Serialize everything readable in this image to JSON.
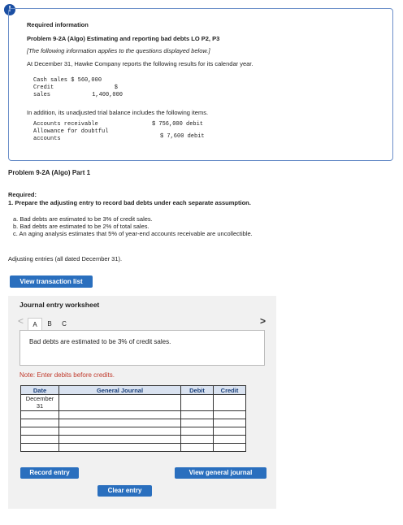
{
  "alert_icon": "!",
  "info": {
    "required_title": "Required information",
    "problem_title": "Problem 9-2A (Algo) Estimating and reporting bad debts LO P2, P3",
    "note": "[The following information applies to the questions displayed below.]",
    "intro": "At December 31, Hawke Company reports the following results for its calendar year.",
    "cash_sales_label": "Cash sales",
    "cash_sales_value": "$ 560,000",
    "credit_label": "Credit",
    "credit_dollar": "$",
    "sales_label": "sales",
    "sales_value": "1,400,000",
    "trial_balance_text": "In addition, its unadjusted trial balance includes the following items.",
    "ar_label": "Accounts receivable",
    "ar_value": "$ 756,000 debit",
    "allowance_label_1": "Allowance for doubtful",
    "allowance_label_2": "accounts",
    "allowance_value": "$ 7,600 debit"
  },
  "part_title": "Problem 9-2A (Algo) Part 1",
  "required": {
    "label": "Required:",
    "item1": "1. Prepare the adjusting entry to record bad debts under each separate assumption.",
    "a": "a. Bad debts are estimated to be 3% of credit sales.",
    "b": "b. Bad debts are estimated to be 2% of total sales.",
    "c": "c. An aging analysis estimates that 5% of year-end accounts receivable are uncollectible."
  },
  "adjusting_label": "Adjusting entries (all dated December 31).",
  "view_transaction_label": "View transaction list",
  "worksheet": {
    "title": "Journal entry worksheet",
    "tabs": [
      "A",
      "B",
      "C"
    ],
    "nav_left": "<",
    "nav_right": ">",
    "description": "Bad debts are estimated to be 3% of credit sales.",
    "note": "Note: Enter debits before credits.",
    "headers": {
      "date": "Date",
      "journal": "General Journal",
      "debit": "Debit",
      "credit": "Credit"
    },
    "date_month": "December",
    "date_day": "31",
    "record_label": "Record entry",
    "clear_label": "Clear entry",
    "view_general_label": "View general journal"
  }
}
